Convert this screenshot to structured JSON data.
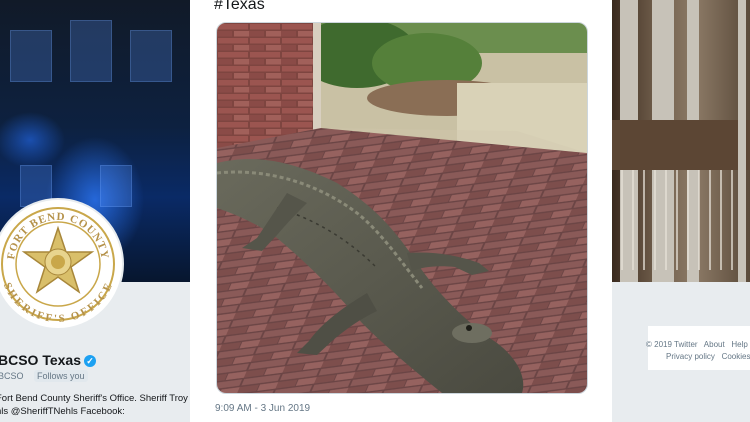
{
  "tweet": {
    "text": "#Texas",
    "timestamp": "9:09 AM - 3 Jun 2019"
  },
  "profile": {
    "badge_top_text": "FORT BEND COUNTY",
    "badge_bottom_text": "SHERIFF'S OFFICE",
    "name": "BCSO Texas",
    "handle": "BCSO",
    "follows_you": "Follows you",
    "bio": "Fort Bend County Sheriff's Office. Sheriff Troy\nhls @SheriffTNehls Facebook:"
  },
  "footer": {
    "copyright": "© 2019 Twitter",
    "about": "About",
    "help": "Help",
    "privacy": "Privacy policy",
    "cookies": "Cookies"
  },
  "colors": {
    "accent": "#1da1f2",
    "brick": "#8f4a45",
    "alligator": "#5b5b4e"
  }
}
